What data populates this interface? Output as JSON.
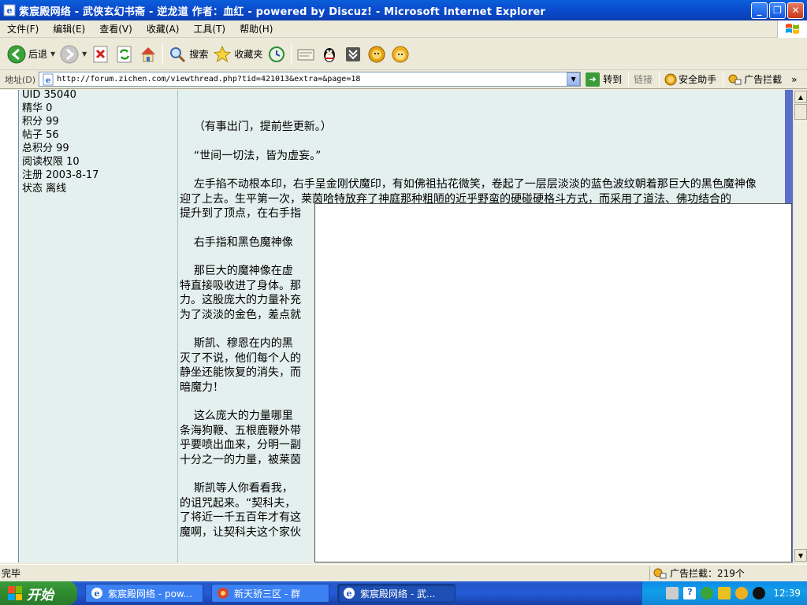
{
  "window": {
    "title": "紫宸殿网络 - 武侠玄幻书斋 - 逆龙道 作者：血红 - powered by Discuz! - Microsoft Internet Explorer",
    "minimize_glyph": "_",
    "restore_glyph": "❐",
    "close_glyph": "✕"
  },
  "menubar": {
    "items": [
      "文件(F)",
      "编辑(E)",
      "查看(V)",
      "收藏(A)",
      "工具(T)",
      "帮助(H)"
    ]
  },
  "toolbar": {
    "back_label": "后退",
    "search_label": "搜索",
    "favorites_label": "收藏夹"
  },
  "addressbar": {
    "label": "地址(D)",
    "url": "http://forum.zichen.com/viewthread.php?tid=421013&extra=&page=18",
    "go_label": "转到",
    "links_label": "链接",
    "security_label": "安全助手",
    "adblock_label": "广告拦截",
    "more_glyph": "»"
  },
  "user": {
    "stats": [
      {
        "label": "UID",
        "value": "35040"
      },
      {
        "label": "精华",
        "value": "0"
      },
      {
        "label": "积分",
        "value": "99"
      },
      {
        "label": "帖子",
        "value": "56"
      },
      {
        "label": "总积分",
        "value": "99"
      },
      {
        "label": "阅读权限",
        "value": "10"
      },
      {
        "label": "注册",
        "value": "2003-8-17"
      },
      {
        "label": "状态",
        "value": "离线"
      }
    ]
  },
  "post": {
    "paragraphs": [
      "    （有事出门，提前些更新。）",
      "    “世间一切法，皆为虚妄。”",
      "    左手掐不动根本印，右手呈金刚伏魔印，有如佛祖拈花微笑，卷起了一层层淡淡的蓝色波纹朝着那巨大的黑色魔神像迎了上去。生平第一次，莱茵哈特放弃了神庭那种粗陋的近乎野蛮的硬碰硬格斗方式，而采用了道法、佛功结合的\n提升到了顶点，在右手指",
      "    右手指和黑色魔神像",
      "    那巨大的魔神像在虚\n特直接吸收进了身体。那\n力。这股庞大的力量补充\n为了淡淡的金色，差点就",
      "    斯凯、穆恩在内的黑\n灭了不说，他们每个人的\n静坐还能恢复的消失，而\n暗魔力！",
      "    这么庞大的力量哪里\n条海狗鞭、五根鹿鞭外带\n乎要喷出血来，分明一副\n十分之一的力量，被莱茵",
      "    斯凯等人你看看我，\n的诅咒起来。“契科夫，\n了将近一千五百年才有这\n魔啊，让契科夫这个家伙"
    ]
  },
  "statusbar": {
    "status": "完毕",
    "adblock": "广告拦截：219个"
  },
  "taskbar": {
    "start_label": "开始",
    "tasks": [
      {
        "label": "紫宸殿网络 - pow..."
      },
      {
        "label": "新天骄三区 - 群"
      },
      {
        "label": "紫宸殿网络 - 武..."
      }
    ],
    "clock": "12:39"
  }
}
